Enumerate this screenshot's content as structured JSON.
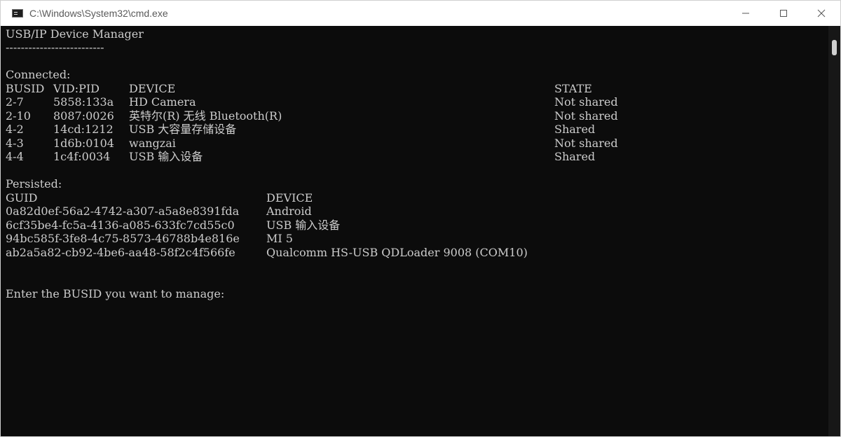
{
  "window": {
    "title": "C:\\Windows\\System32\\cmd.exe",
    "icons": {
      "app": "console-icon",
      "minimize": "minimize-icon",
      "maximize": "maximize-icon",
      "close": "close-icon"
    }
  },
  "console": {
    "title": "USB/IP Device Manager",
    "underline": "--------------------------",
    "connected_label": "Connected:",
    "connected_headers": {
      "busid": "BUSID",
      "vidpid": "VID:PID",
      "device": "DEVICE",
      "state": "STATE"
    },
    "connected": [
      {
        "busid": "2-7",
        "vidpid": "5858:133a",
        "device": "HD Camera",
        "state": "Not shared"
      },
      {
        "busid": "2-10",
        "vidpid": "8087:0026",
        "device": "英特尔(R) 无线 Bluetooth(R)",
        "state": "Not shared"
      },
      {
        "busid": "4-2",
        "vidpid": "14cd:1212",
        "device": "USB 大容量存储设备",
        "state": "Shared"
      },
      {
        "busid": "4-3",
        "vidpid": "1d6b:0104",
        "device": "wangzai",
        "state": "Not shared"
      },
      {
        "busid": "4-4",
        "vidpid": "1c4f:0034",
        "device": "USB 输入设备",
        "state": "Shared"
      }
    ],
    "persisted_label": "Persisted:",
    "persisted_headers": {
      "guid": "GUID",
      "device": "DEVICE"
    },
    "persisted": [
      {
        "guid": "0a82d0ef-56a2-4742-a307-a5a8e8391fda",
        "device": "Android"
      },
      {
        "guid": "6cf35be4-fc5a-4136-a085-633fc7cd55c0",
        "device": "USB 输入设备"
      },
      {
        "guid": "94bc585f-3fe8-4c75-8573-46788b4e816e",
        "device": "MI 5"
      },
      {
        "guid": "ab2a5a82-cb92-4be6-aa48-58f2c4f566fe",
        "device": "Qualcomm HS-USB QDLoader 9008 (COM10)"
      }
    ],
    "prompt": "Enter the BUSID you want to manage:"
  }
}
